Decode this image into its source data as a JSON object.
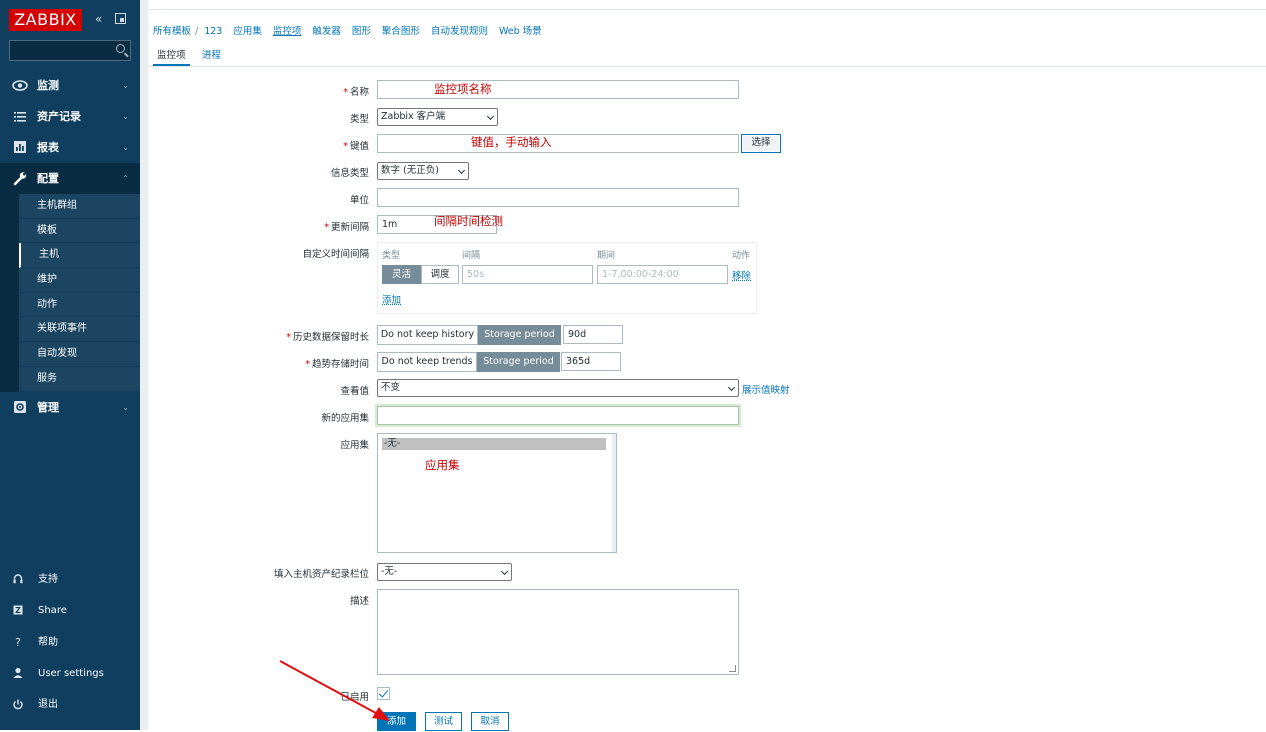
{
  "sidebar": {
    "logo": "ZABBIX",
    "collapse_icon": "«",
    "menu": [
      {
        "label": "监测",
        "icon": "eye-icon"
      },
      {
        "label": "资产记录",
        "icon": "list-icon"
      },
      {
        "label": "报表",
        "icon": "chart-icon"
      },
      {
        "label": "配置",
        "icon": "wrench-icon"
      },
      {
        "label": "管理",
        "icon": "gear-icon"
      }
    ],
    "submenu": [
      "主机群组",
      "模板",
      "主机",
      "维护",
      "动作",
      "关联项事件",
      "自动发现",
      "服务"
    ],
    "bottom": [
      {
        "label": "支持",
        "icon": "headset-icon"
      },
      {
        "label": "Share",
        "icon": "share-icon"
      },
      {
        "label": "帮助",
        "icon": "help-icon"
      },
      {
        "label": "User settings",
        "icon": "user-icon"
      },
      {
        "label": "退出",
        "icon": "power-icon"
      }
    ]
  },
  "breadcrumb": [
    "所有模板",
    "/",
    "123",
    "应用集",
    "监控项",
    "触发器",
    "图形",
    "聚合图形",
    "自动发现规则",
    "Web 场景"
  ],
  "subtabs": [
    "监控项",
    "进程"
  ],
  "form": {
    "name_label": "名称",
    "type_label": "类型",
    "type_value": "Zabbix 客户端",
    "key_label": "键值",
    "select_button": "选择",
    "info_type_label": "信息类型",
    "info_type_value": "数字 (无正负)",
    "unit_label": "单位",
    "update_interval_label": "更新间隔",
    "update_interval_value": "1m",
    "custom_interval_label": "自定义时间间隔",
    "custom": {
      "col_type": "类型",
      "col_interval": "间隔",
      "col_period": "期间",
      "col_action": "动作",
      "flexible": "灵活",
      "scheduling": "调度",
      "interval_placeholder": "50s",
      "period_placeholder": "1-7,00:00-24:00",
      "remove": "移除",
      "add": "添加"
    },
    "history_label": "历史数据保留时长",
    "history_no_keep": "Do not keep history",
    "history_storage": "Storage period",
    "history_value": "90d",
    "trends_label": "趋势存储时间",
    "trends_no_keep": "Do not keep trends",
    "trends_storage": "Storage period",
    "trends_value": "365d",
    "showvalue_label": "查看值",
    "showvalue_value": "不变",
    "show_mapping_link": "展示值映射",
    "new_app_label": "新的应用集",
    "apps_label": "应用集",
    "apps_option": "-无-",
    "inventory_label": "填入主机资产纪录栏位",
    "inventory_value": "-无-",
    "description_label": "描述",
    "enabled_label": "已启用",
    "add_button": "添加",
    "test_button": "测试",
    "cancel_button": "取消"
  },
  "annotations": {
    "name": "监控项名称",
    "key": "键值，手动输入",
    "interval": "间隔时间检测",
    "apps": "应用集"
  },
  "colors": {
    "sidebar": "#0f3e5f",
    "accent": "#0275b8",
    "logo": "#d40000",
    "annotation": "#c00000"
  }
}
